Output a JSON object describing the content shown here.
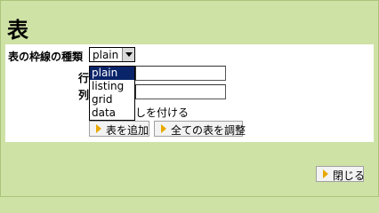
{
  "page": {
    "title": "表"
  },
  "form": {
    "border_label": "表の枠線の種類",
    "border_value": "plain",
    "row_label": "行",
    "col_label": "列",
    "row_value": "",
    "col_value": "",
    "checkbox_label_visible": "しを付ける"
  },
  "dropdown": {
    "options": [
      "plain",
      "listing",
      "grid",
      "data"
    ],
    "selected": "plain"
  },
  "buttons": {
    "add_table": "表を追加",
    "adjust_all": "全ての表を調整",
    "close": "閉じる"
  },
  "colors": {
    "background": "#cfe2a6",
    "highlight": "#0a246a",
    "button_arrow": "#e8a800"
  }
}
